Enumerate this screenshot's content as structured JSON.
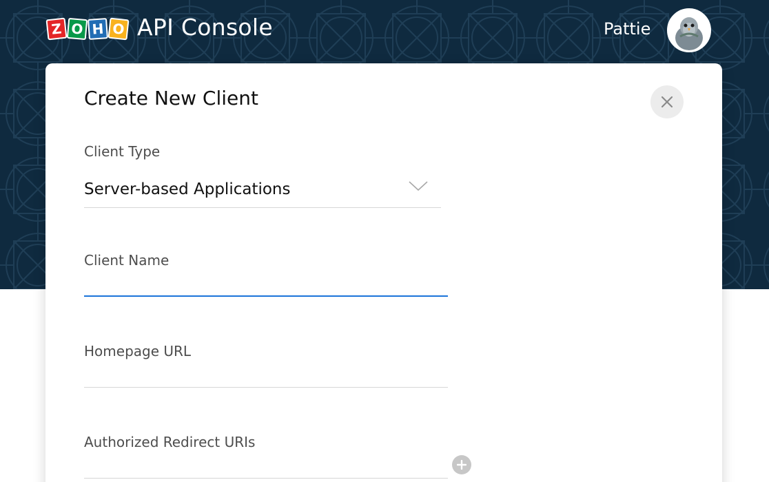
{
  "header": {
    "logo_letters": [
      "Z",
      "O",
      "H",
      "O"
    ],
    "app_title": "API Console",
    "user_name": "Pattie"
  },
  "dialog": {
    "title": "Create New Client",
    "close_icon": "close-icon",
    "client_type": {
      "label": "Client Type",
      "selected": "Server-based Applications",
      "icon": "chevron-down-icon"
    },
    "client_name": {
      "label": "Client Name",
      "value": ""
    },
    "homepage_url": {
      "label": "Homepage URL",
      "value": ""
    },
    "redirect_uris": {
      "label": "Authorized Redirect URIs",
      "value": "",
      "add_icon": "plus-icon"
    }
  },
  "colors": {
    "banner": "#0f2a3f",
    "focus_underline": "#1a73d9",
    "logo_red": "#e42527",
    "logo_green": "#089949",
    "logo_blue": "#226db4",
    "logo_yellow": "#f9b21d"
  }
}
